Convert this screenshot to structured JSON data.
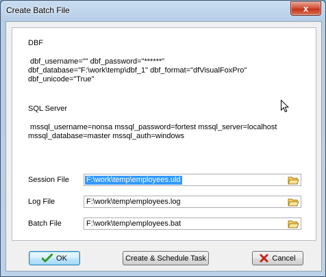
{
  "window": {
    "title": "Create Batch File",
    "close_glyph": "x"
  },
  "hints": {
    "dbf_title": "DBF",
    "dbf_lines": [
      " dbf_username=\"\" dbf_password=\"******\"",
      "dbf_database=\"F:\\work\\temp\\dbf_1\" dbf_format=\"dfVisualFoxPro\"",
      "dbf_unicode=\"True\""
    ],
    "sql_title": "SQL Server",
    "sql_lines": [
      " mssql_username=nonsa mssql_password=fortest mssql_server=localhost",
      "mssql_database=master mssql_auth=windows"
    ]
  },
  "fields": {
    "session": {
      "label": "Session File",
      "value": "F:\\work\\temp\\employees.uld"
    },
    "log": {
      "label": "Log File",
      "value": "F:\\work\\temp\\employees.log"
    },
    "batch": {
      "label": "Batch File",
      "value": "F:\\work\\temp\\employees.bat"
    }
  },
  "buttons": {
    "ok": "OK",
    "schedule": "Create & Schedule Task",
    "cancel": "Cancel"
  },
  "icons": {
    "browse": "folder-open-icon",
    "ok": "checkmark-icon",
    "cancel": "x-icon",
    "close": "close-icon"
  },
  "colors": {
    "selection": "#3399ff",
    "ok_check": "#2e9a1e",
    "cancel_x": "#c4231b",
    "close_button": "#c4321c"
  }
}
